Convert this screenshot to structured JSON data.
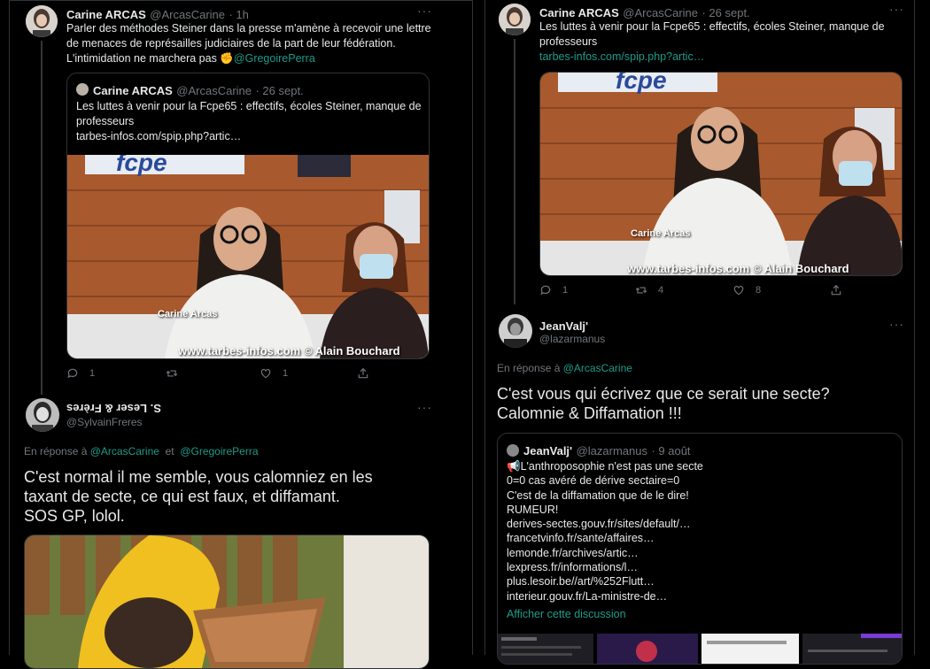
{
  "left": {
    "tweet1": {
      "name": "Carine ARCAS",
      "handle": "@ArcasCarine",
      "time": "· 1h",
      "text_line1": "Parler des méthodes Steiner dans la presse m'amène à recevoir une lettre",
      "text_line2": "de menaces de représailles judiciaires de la part de leur fédération.",
      "text_line3": "L'intimidation ne marchera pas",
      "emoji": "✊",
      "mention": "@GregoirePerra",
      "quote": {
        "name": "Carine ARCAS",
        "handle": "@ArcasCarine",
        "time": "· 26 sept.",
        "line1": "Les luttes à venir pour la Fcpe65 : effectifs, écoles Steiner, manque de",
        "line2": "professeurs",
        "link": "tarbes-infos.com/spip.php?artic…",
        "caption_name": "Carine Arcas",
        "watermark": "www.tarbes-infos.com © Alain Bouchard",
        "logo": "fcpe"
      },
      "replies": "1",
      "retweets": "",
      "likes": "1"
    },
    "tweet2": {
      "name": "S. Leser & Frères",
      "handle": "@SylvainFreres",
      "reply_prefix": "En réponse à",
      "reply_user1": "@ArcasCarine",
      "reply_and": "et",
      "reply_user2": "@GregoirePerra",
      "line1": "C'est normal il me semble, vous calomniez en les",
      "line2": "taxant de secte, ce qui est faux, et diffamant.",
      "line3": "SOS GP, lolol."
    }
  },
  "right": {
    "tweet1": {
      "name": "Carine ARCAS",
      "handle": "@ArcasCarine",
      "time": "· 26 sept.",
      "line1": "Les luttes à venir pour la Fcpe65 : effectifs, écoles Steiner, manque de",
      "line2": "professeurs",
      "link": "tarbes-infos.com/spip.php?artic…",
      "caption_name": "Carine Arcas",
      "watermark": "www.tarbes-infos.com © Alain Bouchard",
      "logo": "fcpe",
      "replies": "1",
      "retweets": "4",
      "likes": "8"
    },
    "tweet2": {
      "name": "JeanValj'",
      "handle": "@lazarmanus",
      "reply_prefix": "En réponse à",
      "reply_user": "@ArcasCarine",
      "line1": "C'est vous qui écrivez que ce serait une secte?",
      "line2": "Calomnie & Diffamation !!!",
      "quote": {
        "name": "JeanValj'",
        "handle": "@lazarmanus",
        "time": "· 9 août",
        "lines": [
          "📢L'anthroposophie n'est pas une secte",
          "0=0 cas avéré de dérive sectaire=0",
          "C'est de la diffamation que de le dire!",
          "RUMEUR!",
          "derives-sectes.gouv.fr/sites/default/…",
          "francetvinfo.fr/sante/affaires…",
          "lemonde.fr/archives/artic…",
          "lexpress.fr/informations/l…",
          "plus.lesoir.be//art/%252Flutt…",
          "interieur.gouv.fr/La-ministre-de…"
        ],
        "show_thread": "Afficher cette discussion"
      }
    }
  },
  "colors": {
    "accent": "#1d9b8a",
    "muted": "#71767b",
    "border": "#2f3336"
  }
}
